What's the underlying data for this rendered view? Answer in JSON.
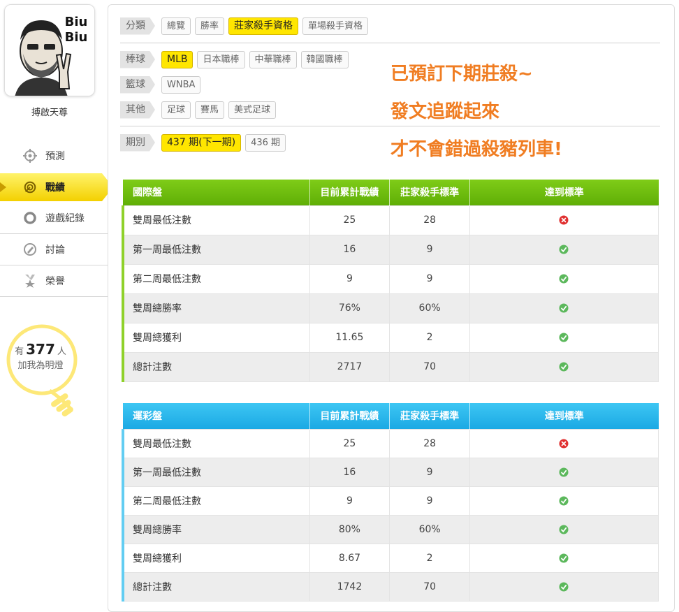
{
  "profile": {
    "avatar_caption": "Biu Biu",
    "username": "搏啟天尊"
  },
  "nav": [
    {
      "label": "預測",
      "icon": "crosshair-icon"
    },
    {
      "label": "戰績",
      "icon": "target-icon",
      "active": true
    },
    {
      "label": "遊戲紀錄",
      "icon": "ring-icon"
    },
    {
      "label": "討論",
      "icon": "chat-pencil-icon"
    },
    {
      "label": "榮譽",
      "icon": "star-medal-icon"
    }
  ],
  "fans": {
    "prefix": "有",
    "count": "377",
    "unit": "人",
    "suffix": "加我為明燈"
  },
  "filters": {
    "category": {
      "head": "分類",
      "chips": [
        "總覽",
        "勝率",
        "莊家殺手資格",
        "單場殺手資格"
      ],
      "active": "莊家殺手資格"
    },
    "baseball": {
      "head": "棒球",
      "chips": [
        "MLB",
        "日本職棒",
        "中華職棒",
        "韓國職棒"
      ],
      "active": "MLB"
    },
    "basketball": {
      "head": "籃球",
      "chips": [
        "WNBA"
      ]
    },
    "other": {
      "head": "其他",
      "chips": [
        "足球",
        "賽馬",
        "美式足球"
      ]
    },
    "period": {
      "head": "期別",
      "chips": [
        "437 期(下一期)",
        "436 期"
      ],
      "active": "437 期(下一期)"
    }
  },
  "promo": {
    "line1": "已預訂下期莊殺~",
    "line2": "發文追蹤起來",
    "line3": "才不會錯過殺豬列車!"
  },
  "colors": {
    "green_header": "#6bbb0c",
    "blue_header": "#26b4ea",
    "accent_yellow": "#ffe600",
    "promo_orange": "#f07d22",
    "pass": "#5cb85c",
    "fail": "#e03030"
  },
  "tables": [
    {
      "headers": [
        "國際盤",
        "目前累計戰績",
        "莊家殺手標準",
        "達到標準"
      ],
      "rows": [
        {
          "label": "雙周最低注數",
          "current": "25",
          "standard": "28",
          "met": "fail"
        },
        {
          "label": "第一周最低注數",
          "current": "16",
          "standard": "9",
          "met": "pass"
        },
        {
          "label": "第二周最低注數",
          "current": "9",
          "standard": "9",
          "met": "pass"
        },
        {
          "label": "雙周總勝率",
          "current": "76%",
          "standard": "60%",
          "met": "pass"
        },
        {
          "label": "雙周總獲利",
          "current": "11.65",
          "standard": "2",
          "met": "pass"
        },
        {
          "label": "總計注數",
          "current": "2717",
          "standard": "70",
          "met": "pass"
        }
      ]
    },
    {
      "headers": [
        "運彩盤",
        "目前累計戰績",
        "莊家殺手標準",
        "達到標準"
      ],
      "rows": [
        {
          "label": "雙周最低注數",
          "current": "25",
          "standard": "28",
          "met": "fail"
        },
        {
          "label": "第一周最低注數",
          "current": "16",
          "standard": "9",
          "met": "pass"
        },
        {
          "label": "第二周最低注數",
          "current": "9",
          "standard": "9",
          "met": "pass"
        },
        {
          "label": "雙周總勝率",
          "current": "80%",
          "standard": "60%",
          "met": "pass"
        },
        {
          "label": "雙周總獲利",
          "current": "8.67",
          "standard": "2",
          "met": "pass"
        },
        {
          "label": "總計注數",
          "current": "1742",
          "standard": "70",
          "met": "pass"
        }
      ]
    }
  ]
}
